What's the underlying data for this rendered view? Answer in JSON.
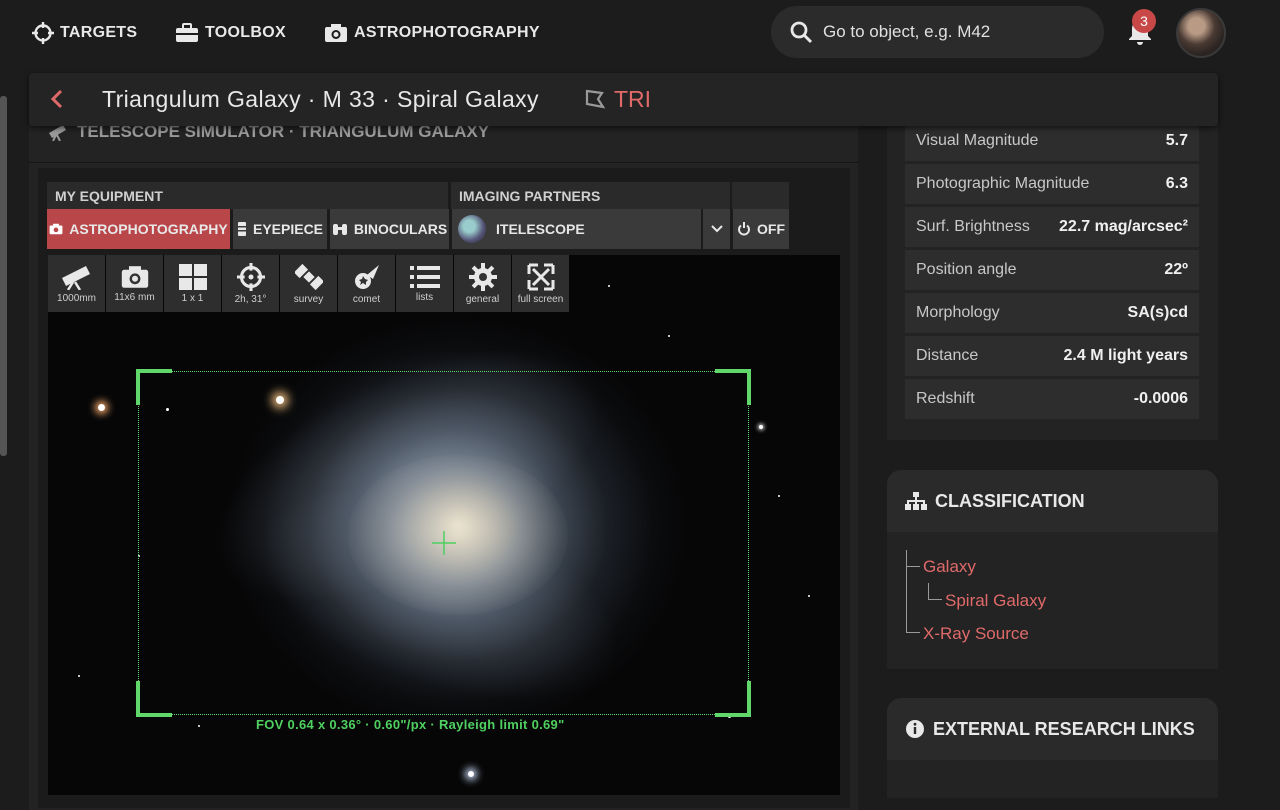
{
  "nav": {
    "items": [
      {
        "label": "TARGETS",
        "icon": "crosshair-icon"
      },
      {
        "label": "TOOLBOX",
        "icon": "toolbox-icon"
      },
      {
        "label": "ASTROPHOTOGRAPHY",
        "icon": "camera-icon"
      }
    ],
    "search_placeholder": "Go to object, e.g. M42",
    "notification_count": "3"
  },
  "title_bar": {
    "title": "Triangulum Galaxy · M 33 · Spiral Galaxy",
    "constellation": "TRI"
  },
  "simulator": {
    "header": "TELESCOPE SIMULATOR · TRIANGULUM GALAXY",
    "my_equipment_label": "MY EQUIPMENT",
    "imaging_partners_label": "IMAGING PARTNERS",
    "equipment_tabs": [
      "ASTROPHOTOGRAPHY",
      "EYEPIECE",
      "BINOCULARS"
    ],
    "partner": "ITELESCOPE",
    "off_label": "OFF",
    "tools": [
      {
        "label": "1000mm",
        "icon": "telescope-icon"
      },
      {
        "label": "11x6 mm",
        "icon": "camera-icon"
      },
      {
        "label": "1 x 1",
        "icon": "grid-icon"
      },
      {
        "label": "2h, 31°",
        "icon": "target-icon"
      },
      {
        "label": "survey",
        "icon": "satellite-icon"
      },
      {
        "label": "comet",
        "icon": "comet-icon"
      },
      {
        "label": "lists",
        "icon": "list-icon"
      },
      {
        "label": "general",
        "icon": "gear-icon"
      },
      {
        "label": "full screen",
        "icon": "fullscreen-icon"
      }
    ],
    "fov_label": "FOV 0.64 x 0.36° · 0.60\"/px · Rayleigh limit 0.69\""
  },
  "properties": [
    {
      "key": "Visual Magnitude",
      "value": "5.7"
    },
    {
      "key": "Photographic Magnitude",
      "value": "6.3"
    },
    {
      "key": "Surf. Brightness",
      "value": "22.7 mag/arcsec²"
    },
    {
      "key": "Position angle",
      "value": "22º"
    },
    {
      "key": "Morphology",
      "value": "SA(s)cd"
    },
    {
      "key": "Distance",
      "value": "2.4 M light years"
    },
    {
      "key": "Redshift",
      "value": "-0.0006"
    }
  ],
  "classification": {
    "title": "CLASSIFICATION",
    "items": [
      "Galaxy",
      "Spiral Galaxy",
      "X-Ray Source"
    ]
  },
  "external_links": {
    "title": "EXTERNAL RESEARCH LINKS"
  },
  "colors": {
    "accent_red": "#e06a6a",
    "active_tab": "#b9474a",
    "fov_green": "#5fd76a"
  }
}
